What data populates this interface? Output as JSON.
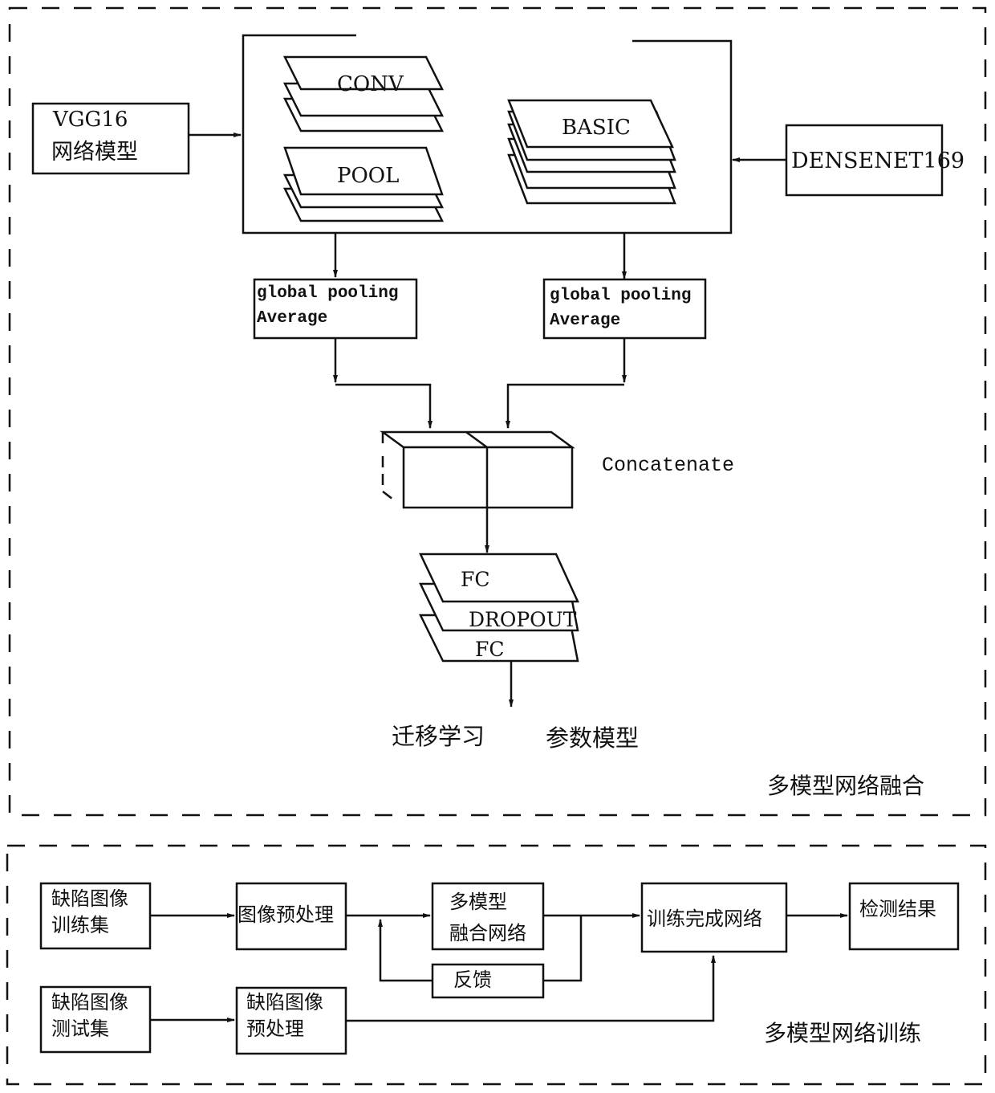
{
  "fusion_section": {
    "title": "多模型网络融合",
    "vgg_box": {
      "line1": "VGG16",
      "line2": "网络模型"
    },
    "densenet_box": {
      "label": "DENSENET169"
    },
    "layers": {
      "conv": "CONV",
      "pool": "POOL",
      "basic": "BASIC"
    },
    "gap_left": {
      "line1": "global pooling",
      "line2": "Average"
    },
    "gap_right": {
      "line1": "global pooling",
      "line2": "Average"
    },
    "concatenate": "Concatenate",
    "head": {
      "fc1": "FC",
      "dropout": "DROPOUT",
      "fc2": "FC"
    },
    "output_left": "迁移学习",
    "output_right": "参数模型"
  },
  "training_section": {
    "title": "多模型网络训练",
    "train_set": {
      "line1": "缺陷图像",
      "line2": "训练集"
    },
    "test_set": {
      "line1": "缺陷图像",
      "line2": "测试集"
    },
    "preprocess": "图像预处理",
    "test_preprocess": {
      "line1": "缺陷图像",
      "line2": "预处理"
    },
    "fusion_net": {
      "line1": "多模型",
      "line2": "融合网络"
    },
    "feedback": "反馈",
    "trained_net": "训练完成网络",
    "result": "检测结果"
  }
}
